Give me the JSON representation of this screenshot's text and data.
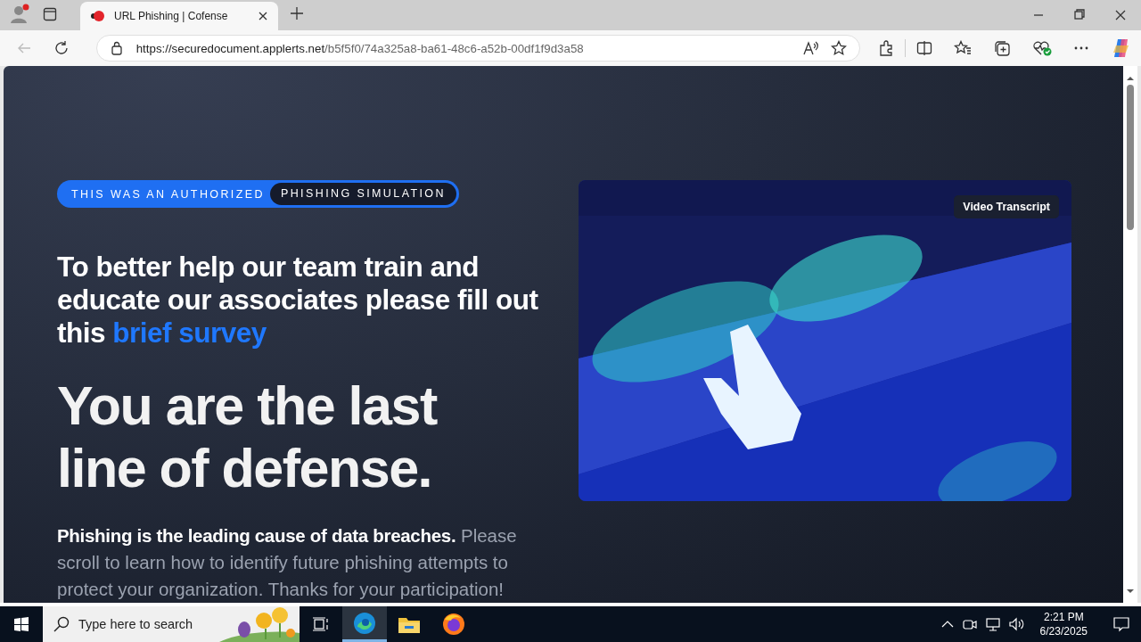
{
  "browser": {
    "tabs": [
      {
        "title": "URL Phishing | Cofense",
        "selected": true
      }
    ],
    "address": {
      "host": "https://securedocument.applerts.net",
      "path": "/b5f5f0/74a325a8-ba61-48c6-a52b-00df1f9d3a58"
    }
  },
  "page": {
    "badge": {
      "left": "THIS WAS AN AUTHORIZED",
      "right": "PHISHING SIMULATION"
    },
    "heading": {
      "text": "To better help our team train and educate our associates please fill out this",
      "link": "brief survey"
    },
    "title": "You are the last line of defense.",
    "intro": "**Phishing is the leading cause of data breaches.** Please scroll to learn how to identify future phishing attempts to protect your organization. Thanks for your participation!",
    "video": {
      "kind": "picture",
      "transcript_button": "Video Transcript"
    }
  },
  "taskbar": {
    "search_placeholder": "Type here to search",
    "apps": [
      {
        "kind": "edge",
        "selected": true
      },
      {
        "kind": "explorer",
        "selected": false
      },
      {
        "kind": "firefox",
        "selected": false
      }
    ],
    "time": "2:21 PM",
    "date": "6/23/2025"
  }
}
